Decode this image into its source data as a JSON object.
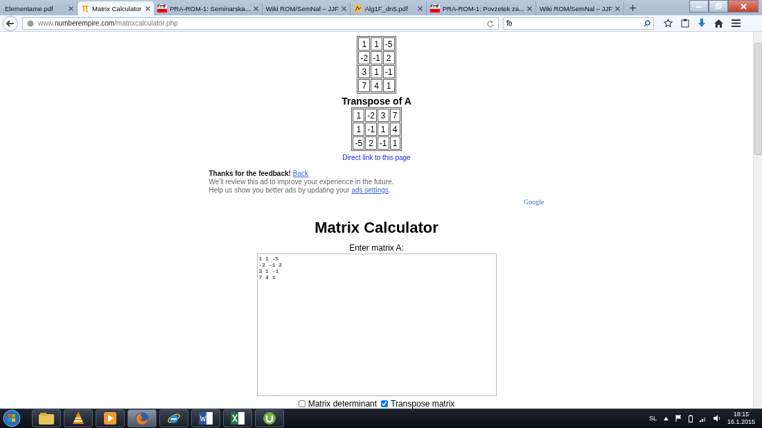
{
  "tabs": [
    {
      "label": "Elementarne.pdf",
      "kind": "none",
      "selected": false
    },
    {
      "label": "Matrix Calculator",
      "kind": "pi",
      "selected": true
    },
    {
      "label": "PRA-ROM-1: Seminarska...",
      "kind": "fmf",
      "selected": false
    },
    {
      "label": "Wiki ROM/SemNal – JJF",
      "kind": "none",
      "selected": false
    },
    {
      "label": "Alg1F_dn5.pdf",
      "kind": "pdf",
      "selected": false
    },
    {
      "label": "PRA-ROM-1: Povzetek za...",
      "kind": "fmf",
      "selected": false
    },
    {
      "label": "Wiki ROM/SemNal – JJF",
      "kind": "none",
      "selected": false
    }
  ],
  "address": {
    "prefix": "www.",
    "domain": "numberempire.com",
    "path": "/matrixcalculator.php"
  },
  "search": {
    "value": "fb"
  },
  "matrix": [
    [
      "1",
      "1",
      "-5"
    ],
    [
      "-2",
      "-1",
      "2"
    ],
    [
      "3",
      "1",
      "-1"
    ],
    [
      "7",
      "4",
      "1"
    ]
  ],
  "transpose_heading": "Transpose of A",
  "transpose": [
    [
      "1",
      "-2",
      "3",
      "7"
    ],
    [
      "1",
      "-1",
      "1",
      "4"
    ],
    [
      "-5",
      "2",
      "-1",
      "1"
    ]
  ],
  "direct_link": "Direct link to this page",
  "feedback": {
    "thanks": "Thanks for the feedback!",
    "back": "Back",
    "line1": "We'll review this ad to improve your experience in the future.",
    "line2": "Help us show you better ads by updating your",
    "link": "ads settings",
    "end": ".",
    "brand": "Google"
  },
  "title": "Matrix Calculator",
  "input_label": "Enter matrix A:",
  "input_value": "1 1 -5\n-2 -1 2\n3 1 -1\n7 4 1",
  "options": [
    {
      "label": "Matrix determinant",
      "checked": false
    },
    {
      "label": "Transpose matrix",
      "checked": true
    }
  ],
  "taskbar": [
    {
      "kind": "explorer",
      "selected": false
    },
    {
      "kind": "vlc",
      "selected": false
    },
    {
      "kind": "player",
      "selected": false
    },
    {
      "kind": "firefox",
      "selected": true
    },
    {
      "kind": "ie",
      "selected": false
    },
    {
      "kind": "word",
      "selected": false
    },
    {
      "kind": "excel",
      "selected": false
    },
    {
      "kind": "torrent",
      "selected": false
    }
  ],
  "tray": {
    "language": "SL",
    "time": "18:15",
    "date": "16.1.2015"
  }
}
